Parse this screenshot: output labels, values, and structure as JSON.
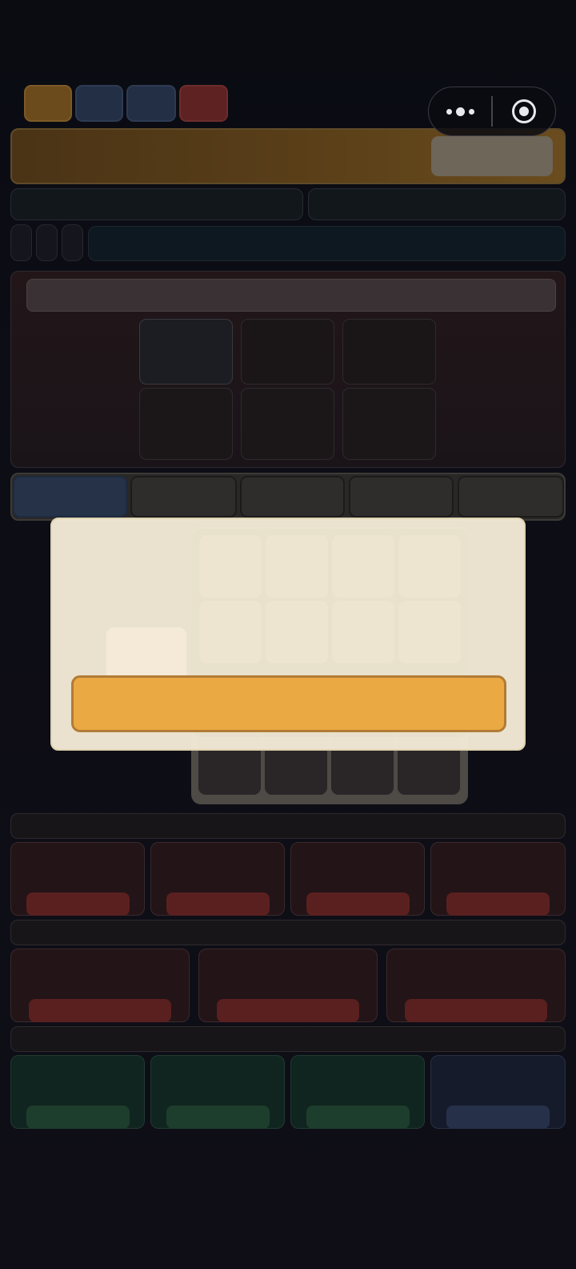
{
  "top_chips": {
    "colors": [
      "#6b4a1c",
      "#232f45",
      "#232f45",
      "#5e2222"
    ]
  },
  "capsule": {
    "menu_icon": "more-dots-icon",
    "close_icon": "target-circle-icon"
  },
  "banner": {
    "color": "#5a3f18",
    "button_color": "#6d6659"
  },
  "panel": {
    "cell_rows": 2,
    "cell_cols": 3,
    "highlighted_cell": 0
  },
  "tabs": {
    "count": 5,
    "active_index": 0
  },
  "keypad": {
    "rows": 4,
    "cols": 4
  },
  "modal": {
    "button_color": "#eaa943",
    "background": "#f2e9d6"
  },
  "bottom": {
    "section_a_cards": 4,
    "section_b_cards": 3,
    "section_c_cards": 4,
    "accent_red": "#5a201f",
    "accent_green": "#1e3e2d",
    "accent_blue": "#263149"
  }
}
